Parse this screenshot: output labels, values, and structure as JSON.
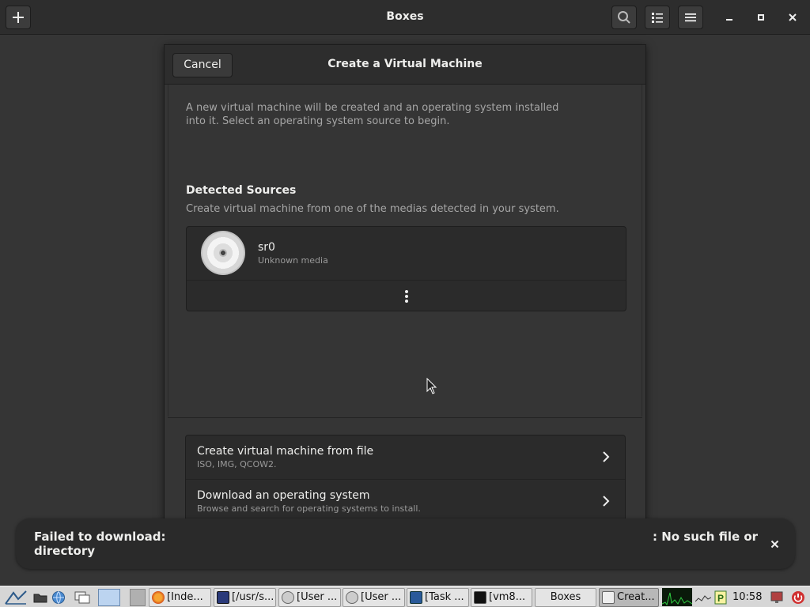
{
  "app": {
    "title": "Boxes"
  },
  "dialog": {
    "cancel_label": "Cancel",
    "title": "Create a Virtual Machine",
    "intro": "A new virtual machine will be created and an operating system installed into it. Select an operating system source to begin.",
    "detected": {
      "heading": "Detected Sources",
      "description": "Create virtual machine from one of the medias detected in your system.",
      "items": [
        {
          "name": "sr0",
          "subtitle": "Unknown media",
          "icon": "optical-disc-icon"
        }
      ]
    },
    "options": [
      {
        "title": "Create virtual machine from file",
        "subtitle": "ISO, IMG, QCOW2."
      },
      {
        "title": "Download an operating system",
        "subtitle": "Browse and search for operating systems to install."
      }
    ]
  },
  "notification": {
    "text_start": "Failed to download:",
    "text_end": ": No such file or",
    "text_line2": "directory"
  },
  "taskbar": {
    "tasks": [
      {
        "label": "[Inde...",
        "icon": "firefox-icon"
      },
      {
        "label": "[/usr/s...",
        "icon": "terminal-icon"
      },
      {
        "label": "[User ...",
        "icon": "settings-icon"
      },
      {
        "label": "[User ...",
        "icon": "settings-icon"
      },
      {
        "label": "[Task ...",
        "icon": "task-manager-icon"
      },
      {
        "label": "[vm8...",
        "icon": "terminal-icon"
      },
      {
        "label": "Boxes",
        "icon": ""
      },
      {
        "label": "Creat...",
        "icon": "boxes-icon"
      }
    ],
    "clock": "10:58"
  },
  "colors": {
    "background": "#353535",
    "headerbar": "#2d2d2d",
    "list_background": "#2b2b2b",
    "taskbar": "#d6d6d6"
  }
}
